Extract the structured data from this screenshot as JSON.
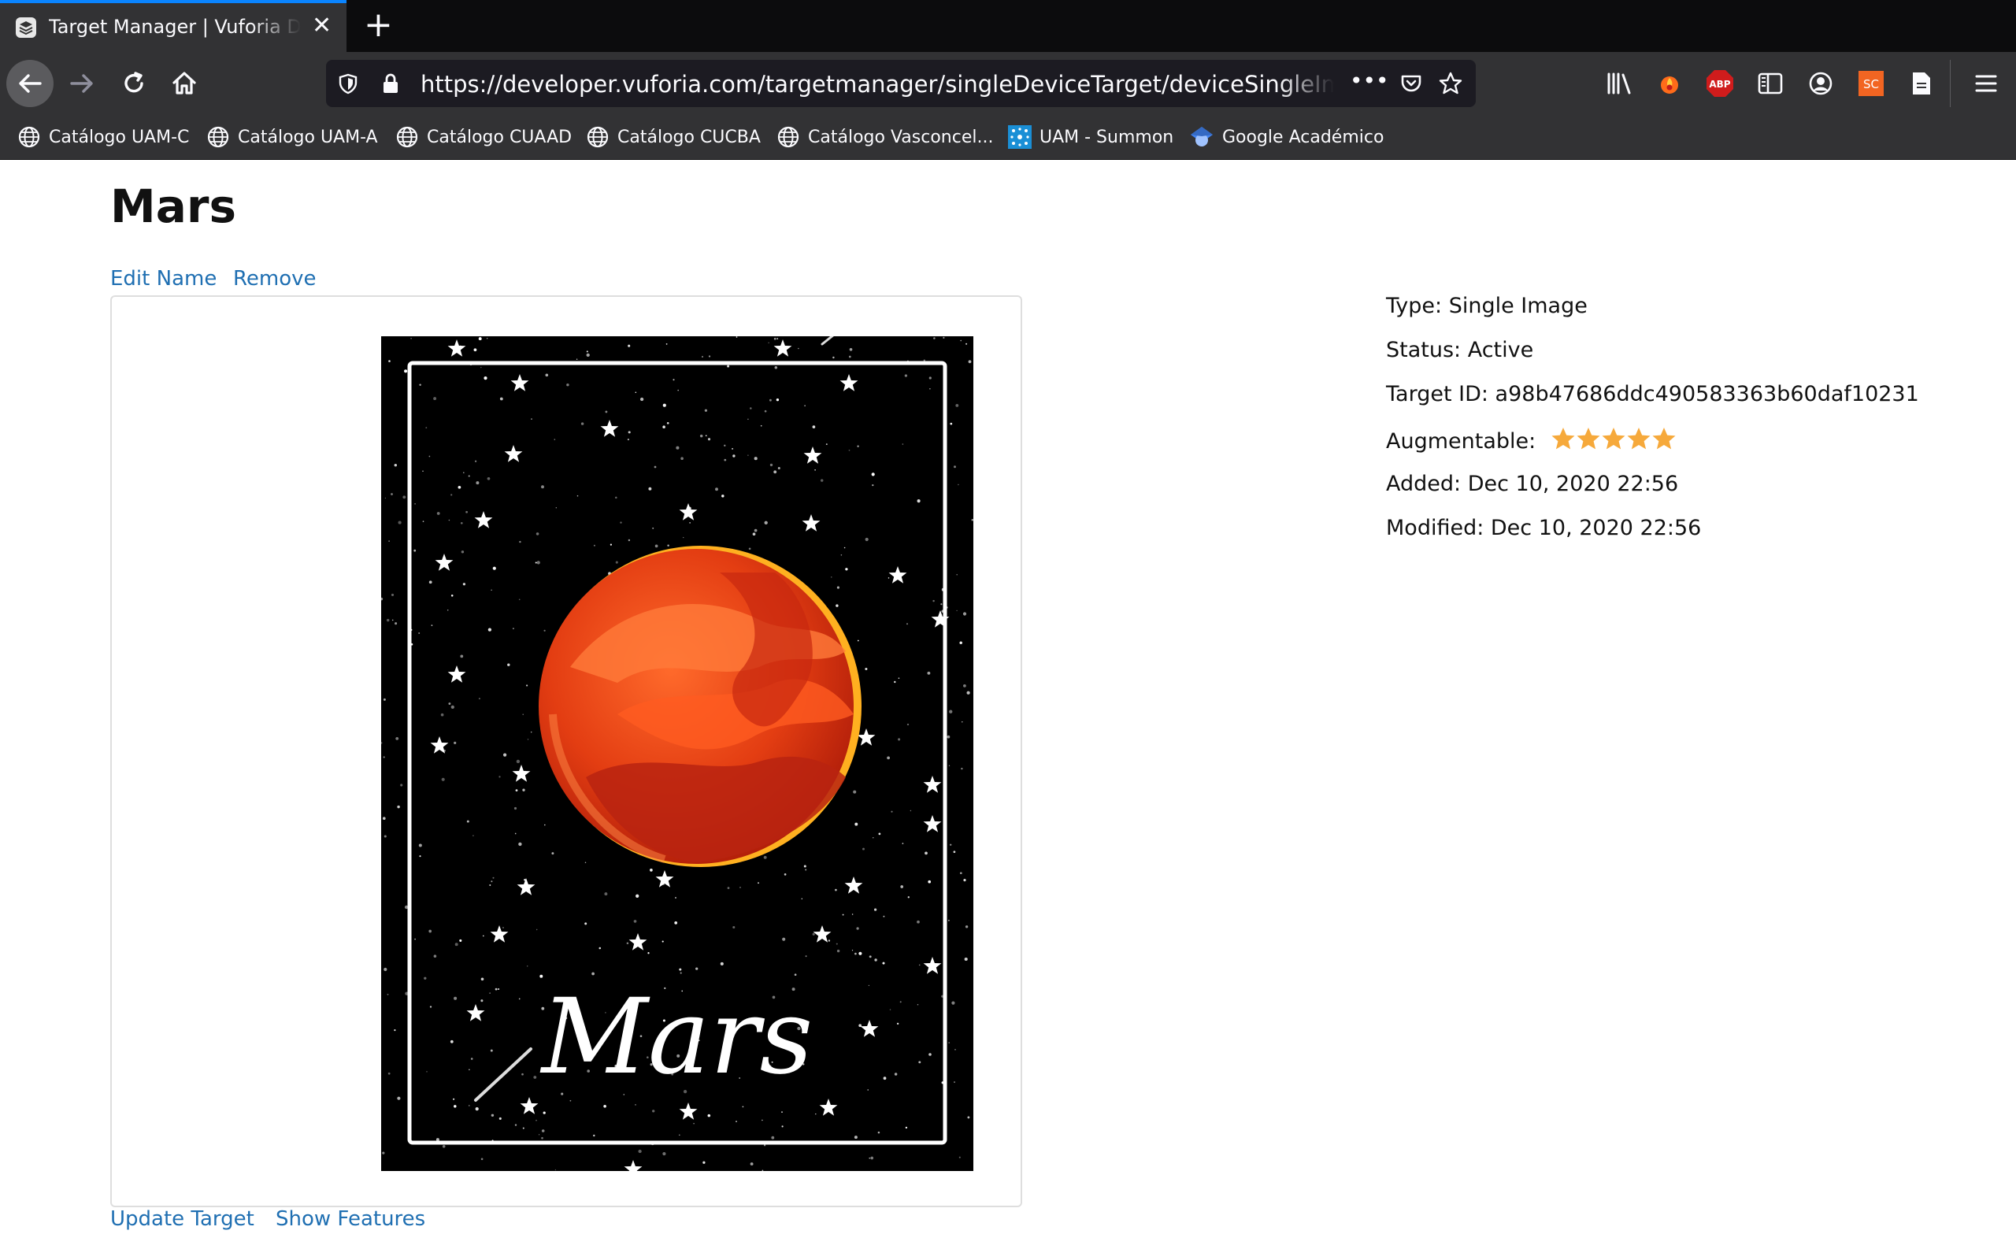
{
  "browser": {
    "tab_title": "Target Manager | Vuforia Developer Portal",
    "tab_close": "✕",
    "new_tab": "+",
    "url": "https://developer.vuforia.com/targetmanager/singleDeviceTarget/deviceSingleImageTargetDetails",
    "url_more": "•••",
    "bookmarks": [
      {
        "label": "Catálogo UAM-C",
        "icon": "globe-icon"
      },
      {
        "label": "Catálogo UAM-A",
        "icon": "globe-icon"
      },
      {
        "label": "Catálogo CUAAD",
        "icon": "globe-icon"
      },
      {
        "label": "Catálogo CUCBA",
        "icon": "globe-icon"
      },
      {
        "label": "Catálogo Vasconcel...",
        "icon": "globe-icon"
      },
      {
        "label": "UAM - Summon",
        "icon": "summon-icon"
      },
      {
        "label": "Google Académico",
        "icon": "scholar-icon"
      }
    ],
    "toolbar": {
      "abp_label": "ABP",
      "sc_label": "SC"
    },
    "colors": {
      "accent": "#0a84ff",
      "chrome": "#323234",
      "tabstrip": "#0c0c0d"
    }
  },
  "page": {
    "title": "Mars",
    "actions": {
      "edit_name": "Edit Name",
      "remove": "Remove"
    },
    "bottom_actions": {
      "update_target": "Update Target",
      "show_features": "Show Features"
    },
    "image": {
      "alt": "Mars target image: red planet on starry background",
      "caption": "Mars"
    },
    "details": {
      "type": "Type: Single Image",
      "status": "Status: Active",
      "target_id": "Target ID: a98b47686ddc490583363b60daf10231",
      "augmentable_label": "Augmentable:",
      "augmentable_rating": 5,
      "augmentable_max": 5,
      "added": "Added: Dec 10, 2020 22:56",
      "modified": "Modified: Dec 10, 2020 22:56"
    },
    "colors": {
      "link": "#1f6fb2",
      "star": "#f6a93b"
    }
  }
}
